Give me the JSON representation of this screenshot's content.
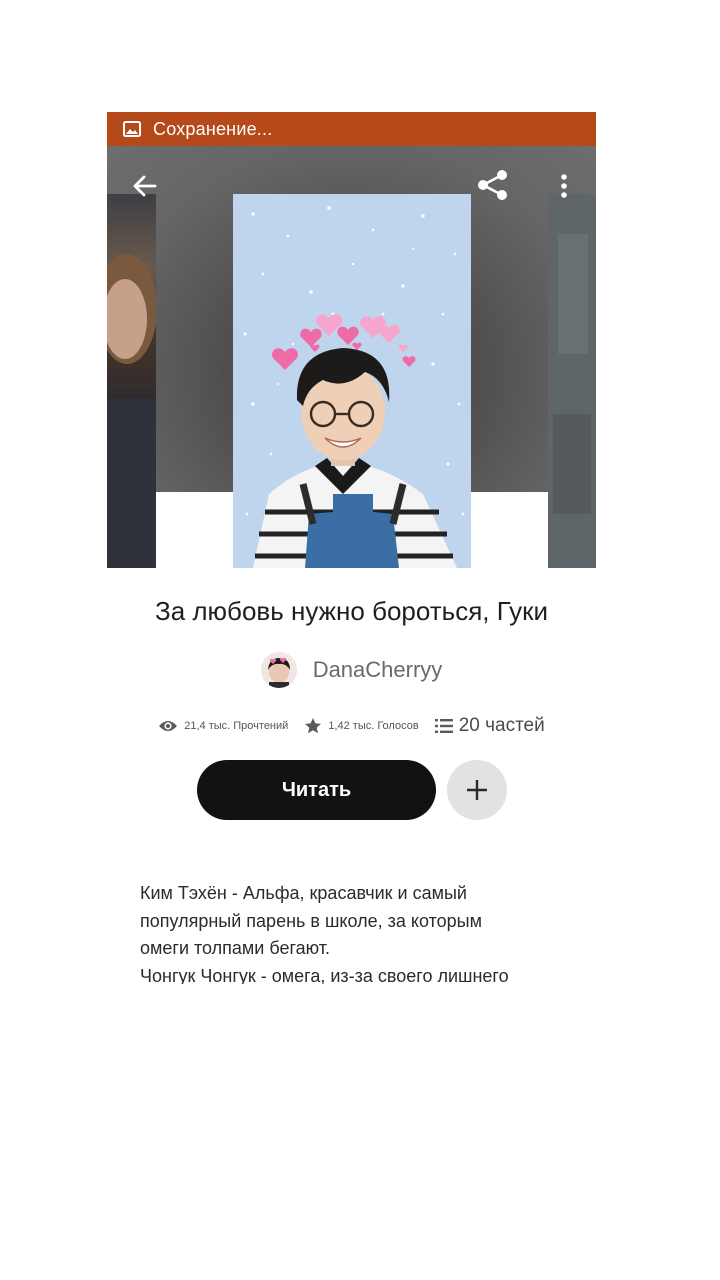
{
  "status_bar": {
    "text": "Сохранение...",
    "color": "#b5491a",
    "icon": "image-icon"
  },
  "toolbar": {
    "back_icon": "arrow-left-icon",
    "share_icon": "share-icon",
    "more_icon": "more-vertical-icon"
  },
  "book": {
    "title": "За любовь нужно бороться, Гуки",
    "author": "DanaCherryy",
    "stats": {
      "reads": "21,4 тыс. Прочтений",
      "votes": "1,42 тыс. Голосов",
      "parts": "20 частей"
    },
    "read_button": "Читать",
    "add_button_icon": "plus-icon",
    "description": [
      "Ким Тэхён - Альфа, красавчик и самый",
      "популярный парень в школе, за которым",
      "омеги толпами бегают.",
      "Чонгук Чонгук - омега, из-за своего лишнего"
    ]
  }
}
